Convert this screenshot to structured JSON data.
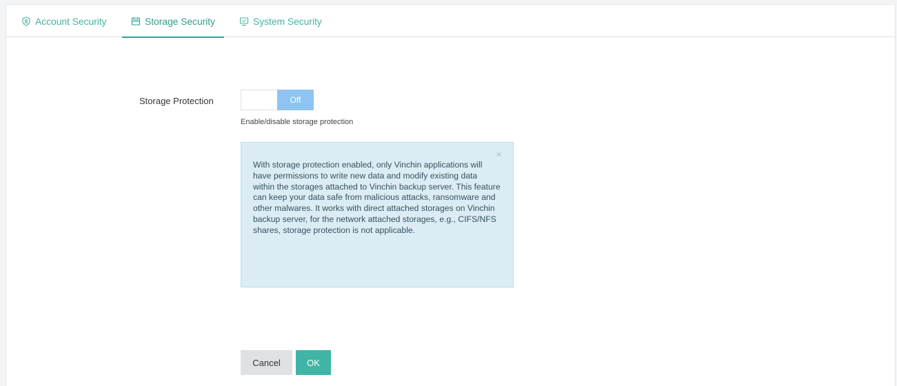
{
  "tabs": [
    {
      "label": "Account Security",
      "icon": "shield-icon",
      "active": false
    },
    {
      "label": "Storage Security",
      "icon": "storage-icon",
      "active": true
    },
    {
      "label": "System Security",
      "icon": "monitor-icon",
      "active": false
    }
  ],
  "form": {
    "storage_protection_label": "Storage Protection",
    "toggle_state": "Off",
    "toggle_hint": "Enable/disable storage protection"
  },
  "alert": {
    "text": "With storage protection enabled, only Vinchin applications will have permissions to write new data and modify existing data within the storages attached to Vinchin backup server. This feature can keep your data safe from malicious attacks, ransomware and other malwares. It works with direct attached storages on Vinchin backup server, for the network attached storages, e.g., CIFS/NFS shares, storage protection is not applicable.",
    "close_symbol": "×"
  },
  "buttons": {
    "cancel": "Cancel",
    "ok": "OK"
  },
  "colors": {
    "accent": "#2aa394",
    "toggle_off": "#8ec4f2",
    "alert_bg": "#dcecf5",
    "ok_button": "#40b5a6"
  }
}
